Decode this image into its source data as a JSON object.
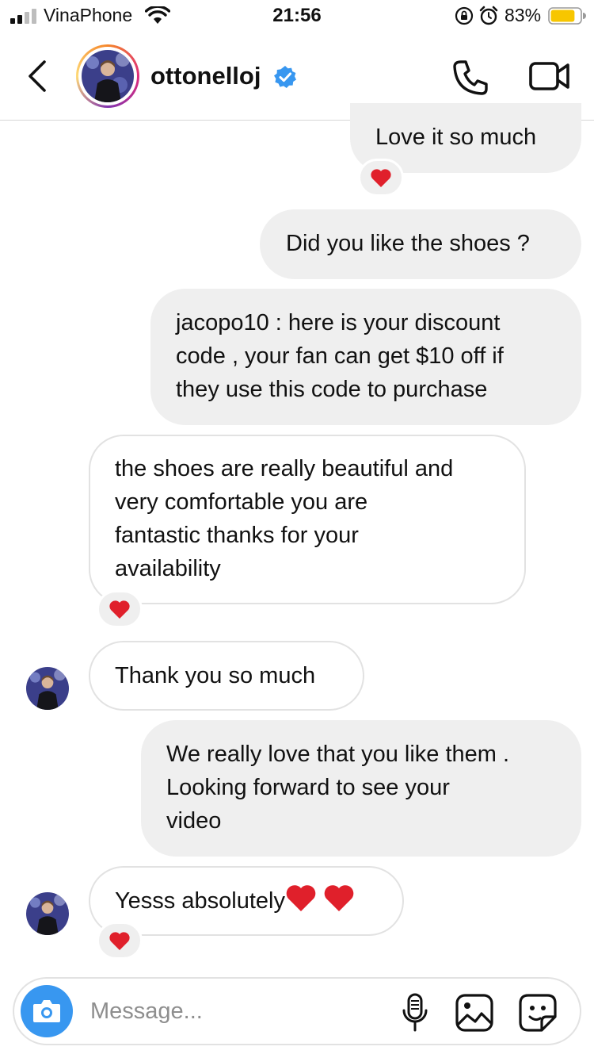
{
  "status_bar": {
    "carrier": "VinaPhone",
    "time": "21:56",
    "battery_percent": "83%",
    "battery_level": 0.83,
    "signal_bars_active": 2,
    "signal_bars_total": 4
  },
  "header": {
    "username": "ottonelloj",
    "verified": true,
    "icons": [
      "back-icon",
      "phone-icon",
      "video-camera-icon",
      "verified-badge-icon"
    ]
  },
  "messages": [
    {
      "side": "outgoing",
      "text": "Love it so much",
      "reaction": "❤️"
    },
    {
      "side": "outgoing",
      "text": "Did you like the shoes ?"
    },
    {
      "side": "outgoing",
      "lines": [
        "jacopo10 : here is your discount",
        "code , your fan can get $10 off if",
        "they use this code to purchase"
      ]
    },
    {
      "side": "incoming",
      "lines": [
        "the shoes are really beautiful and",
        "very comfortable you are",
        "fantastic thanks for your",
        "availability"
      ],
      "reaction": "❤️"
    },
    {
      "side": "incoming",
      "text": "Thank you so much",
      "show_avatar": true
    },
    {
      "side": "outgoing",
      "lines": [
        "We really love that you like them .",
        "Looking forward to see your",
        "video"
      ]
    },
    {
      "side": "incoming",
      "text": "Yesss absolutely",
      "trailing_emoji": "❤️ ❤️",
      "show_avatar": true,
      "reaction": "❤️"
    }
  ],
  "composer": {
    "placeholder": "Message...",
    "icons": [
      "camera-icon",
      "microphone-icon",
      "gallery-icon",
      "sticker-icon"
    ]
  },
  "colors": {
    "accent_blue": "#3897f0",
    "heart_red": "#e0202b",
    "outgoing_bubble": "#efefef",
    "battery_yellow": "#f7c600"
  }
}
